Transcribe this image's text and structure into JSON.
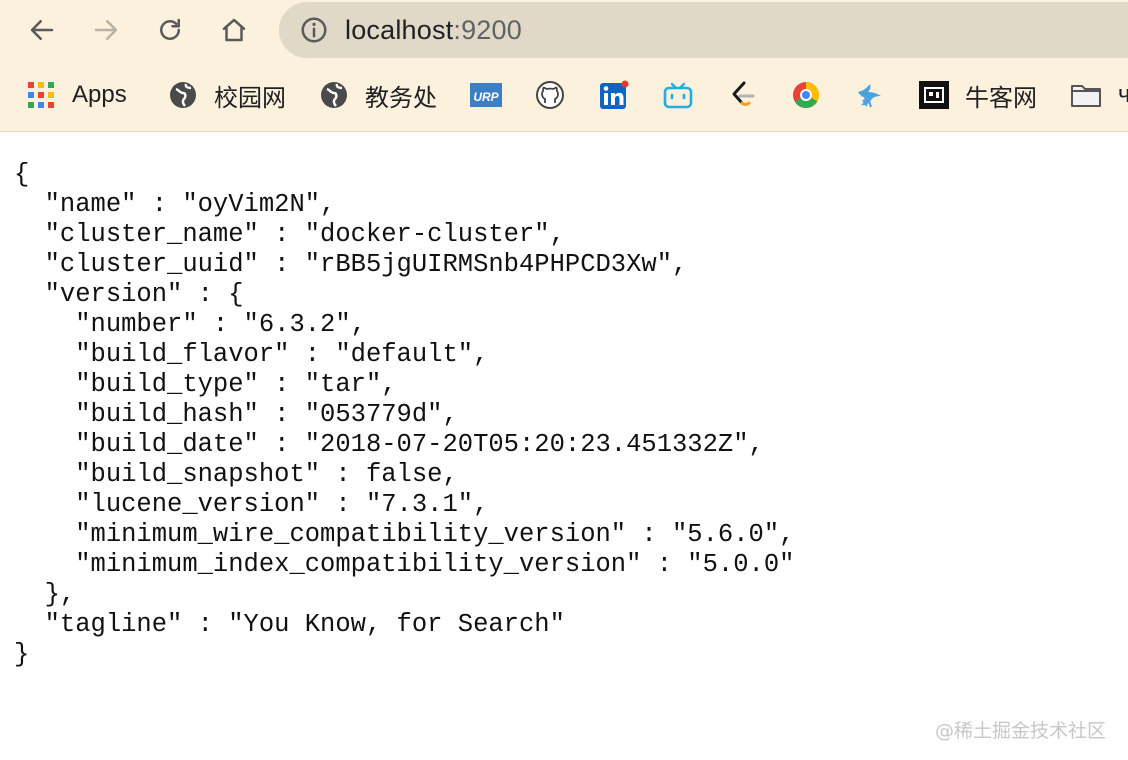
{
  "browser": {
    "url_host": "localhost",
    "url_port": ":9200",
    "nav": {
      "back_icon": "arrow-left-icon",
      "forward_icon": "arrow-right-icon",
      "reload_icon": "reload-icon",
      "home_icon": "home-icon"
    },
    "bookmarks": [
      {
        "label": "Apps",
        "icon": "apps-grid-icon"
      },
      {
        "label": "校园网",
        "icon": "globe-icon"
      },
      {
        "label": "教务处",
        "icon": "globe-icon"
      },
      {
        "label": "",
        "icon": "urp-icon"
      },
      {
        "label": "",
        "icon": "github-icon"
      },
      {
        "label": "",
        "icon": "linkedin-icon"
      },
      {
        "label": "",
        "icon": "bilibili-icon"
      },
      {
        "label": "",
        "icon": "leetcode-icon"
      },
      {
        "label": "",
        "icon": "chrome-like-icon"
      },
      {
        "label": "",
        "icon": "bird-icon"
      },
      {
        "label": "牛客网",
        "icon": "nowcoder-icon"
      },
      {
        "label": "ч",
        "icon": "folder-icon"
      }
    ]
  },
  "response": {
    "lines": [
      "{",
      "  \"name\" : \"oyVim2N\",",
      "  \"cluster_name\" : \"docker-cluster\",",
      "  \"cluster_uuid\" : \"rBB5jgUIRMSnb4PHPCD3Xw\",",
      "  \"version\" : {",
      "    \"number\" : \"6.3.2\",",
      "    \"build_flavor\" : \"default\",",
      "    \"build_type\" : \"tar\",",
      "    \"build_hash\" : \"053779d\",",
      "    \"build_date\" : \"2018-07-20T05:20:23.451332Z\",",
      "    \"build_snapshot\" : false,",
      "    \"lucene_version\" : \"7.3.1\",",
      "    \"minimum_wire_compatibility_version\" : \"5.6.0\",",
      "    \"minimum_index_compatibility_version\" : \"5.0.0\"",
      "  },",
      "  \"tagline\" : \"You Know, for Search\"",
      "}"
    ]
  },
  "watermark": "@稀土掘金技术社区"
}
